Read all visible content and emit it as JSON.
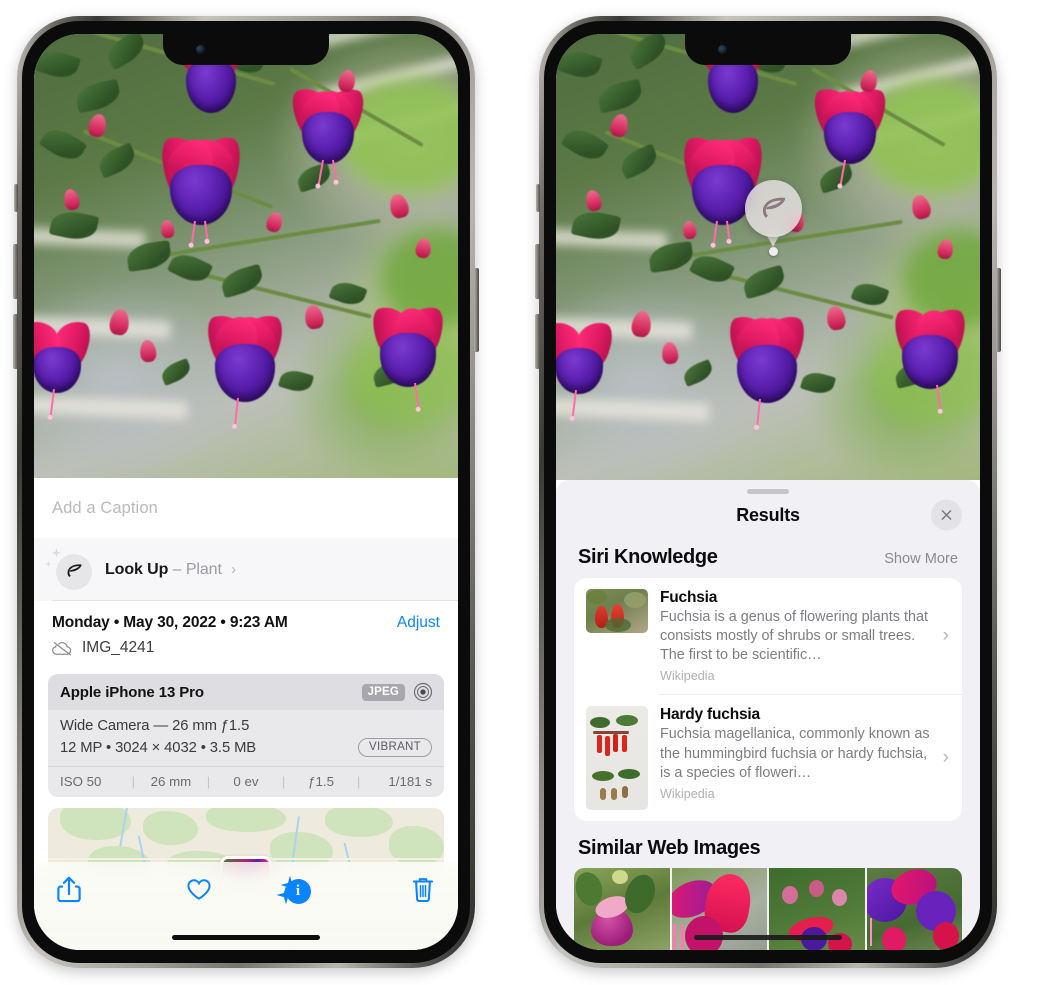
{
  "app": "Photos — Visual Look Up",
  "left_phone": {
    "caption": {
      "placeholder": "Add a Caption",
      "value": ""
    },
    "look_up": {
      "label": "Look Up",
      "dash": "–",
      "subject": "Plant",
      "chevron": "›",
      "icon": "leaf-icon"
    },
    "metadata": {
      "date_line": "Monday • May 30, 2022 • 9:23 AM",
      "adjust_label": "Adjust",
      "filename": "IMG_4241",
      "cloud_icon": "icloud-slash-icon"
    },
    "camera_card": {
      "device": "Apple iPhone 13 Pro",
      "format_chip": "JPEG",
      "raw_icon": "raw-target-icon",
      "lens_line": "Wide Camera — 26 mm ƒ1.5",
      "size_line": "12 MP • 3024 × 4032 • 3.5 MB",
      "style_chip": "VIBRANT",
      "exif": [
        "ISO 50",
        "26 mm",
        "0 ev",
        "ƒ1.5",
        "1/181 s"
      ]
    },
    "map": {
      "label": "photo-location-map"
    },
    "toolbar": [
      {
        "name": "share-button",
        "icon": "share-icon"
      },
      {
        "name": "favorite-button",
        "icon": "heart-icon"
      },
      {
        "name": "info-button",
        "icon": "info-sparkle-icon",
        "glyph": "i",
        "active": true
      },
      {
        "name": "delete-button",
        "icon": "trash-icon"
      }
    ]
  },
  "right_phone": {
    "vlu_badge": {
      "icon": "leaf-icon",
      "label": "visual-look-up-indicator"
    },
    "sheet": {
      "title": "Results",
      "close_icon": "close-x-icon",
      "sections": [
        {
          "title": "Siri Knowledge",
          "action": "Show More",
          "items": [
            {
              "title": "Fuchsia",
              "description": "Fuchsia is a genus of flowering plants that consists mostly of shrubs or small trees. The first to be scientific…",
              "source": "Wikipedia",
              "chevron": "›"
            },
            {
              "title": "Hardy fuchsia",
              "description": "Fuchsia magellanica, commonly known as the hummingbird fuchsia or hardy fuchsia, is a species of floweri…",
              "source": "Wikipedia",
              "chevron": "›"
            }
          ]
        },
        {
          "title": "Similar Web Images",
          "images": [
            "fuchsia-pink-purple-bloom",
            "fuchsia-red-magenta-closeup",
            "fuchsia-bush-red-buds",
            "fuchsia-purple-violet-cluster"
          ]
        }
      ]
    }
  },
  "colors": {
    "accent_blue": "#0a84ff",
    "sheet_bg": "#f1f1f5",
    "card_bg": "#ffffff",
    "camera_card_bg": "#e9e9ec",
    "camera_head_bg": "#dedee2",
    "secondary_text": "#8a8a90"
  }
}
